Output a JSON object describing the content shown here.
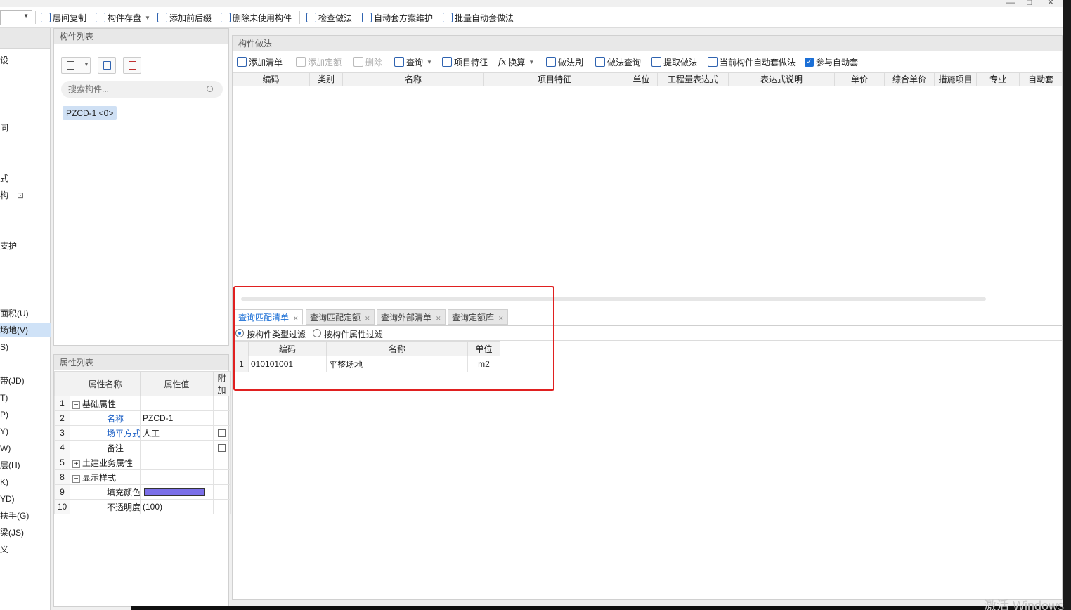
{
  "toolbar": {
    "items": [
      "层间复制",
      "构件存盘",
      "添加前后缀",
      "删除未使用构件",
      "检查做法",
      "自动套方案维护",
      "批量自动套做法"
    ]
  },
  "left_nav": {
    "items": [
      "设",
      "同",
      "式",
      "构",
      "支护",
      "面积(U)",
      "场地(V)",
      "S)",
      "带(JD)",
      "T)",
      "P)",
      "Y)",
      "W)",
      "层(H)",
      "K)",
      "YD)",
      "扶手(G)",
      "梁(JS)",
      "义"
    ],
    "selected": "场地(V)"
  },
  "component_list": {
    "title": "构件列表",
    "search_placeholder": "搜索构件...",
    "item": "PZCD-1 <0>"
  },
  "property_list": {
    "title": "属性列表",
    "headers": [
      "属性名称",
      "属性值",
      "附加"
    ],
    "rows": [
      {
        "idx": "1",
        "name": "基础属性",
        "value": "",
        "expander": "−"
      },
      {
        "idx": "2",
        "name": "名称",
        "value": "PZCD-1"
      },
      {
        "idx": "3",
        "name": "场平方式",
        "value": "人工"
      },
      {
        "idx": "4",
        "name": "备注",
        "value": ""
      },
      {
        "idx": "5",
        "name": "土建业务属性",
        "value": "",
        "expander": "+"
      },
      {
        "idx": "8",
        "name": "显示样式",
        "value": "",
        "expander": "−"
      },
      {
        "idx": "9",
        "name": "填充颜色",
        "value": ""
      },
      {
        "idx": "10",
        "name": "不透明度",
        "value": "(100)"
      }
    ],
    "fill_color": "#7b6fe8"
  },
  "method_panel": {
    "title": "构件做法",
    "tools": [
      "添加清单",
      "添加定额",
      "删除",
      "查询",
      "项目特征",
      "换算",
      "做法刷",
      "做法查询",
      "提取做法",
      "当前构件自动套做法",
      "参与自动套"
    ],
    "columns": [
      "编码",
      "类别",
      "名称",
      "项目特征",
      "单位",
      "工程量表达式",
      "表达式说明",
      "单价",
      "综合单价",
      "措施项目",
      "专业",
      "自动套"
    ]
  },
  "query_panel": {
    "tabs": [
      "查询匹配清单",
      "查询匹配定额",
      "查询外部清单",
      "查询定额库"
    ],
    "filters": [
      "按构件类型过滤",
      "按构件属性过滤"
    ],
    "columns": [
      "编码",
      "名称",
      "单位"
    ],
    "rows": [
      {
        "idx": "1",
        "code": "010101001",
        "name": "平整场地",
        "unit": "m2"
      }
    ]
  },
  "watermark": "激活 Windows",
  "colors": {
    "accent": "#1b6fd6",
    "highlight_box": "#e02020",
    "selected_nav": "#cfe2f7"
  }
}
